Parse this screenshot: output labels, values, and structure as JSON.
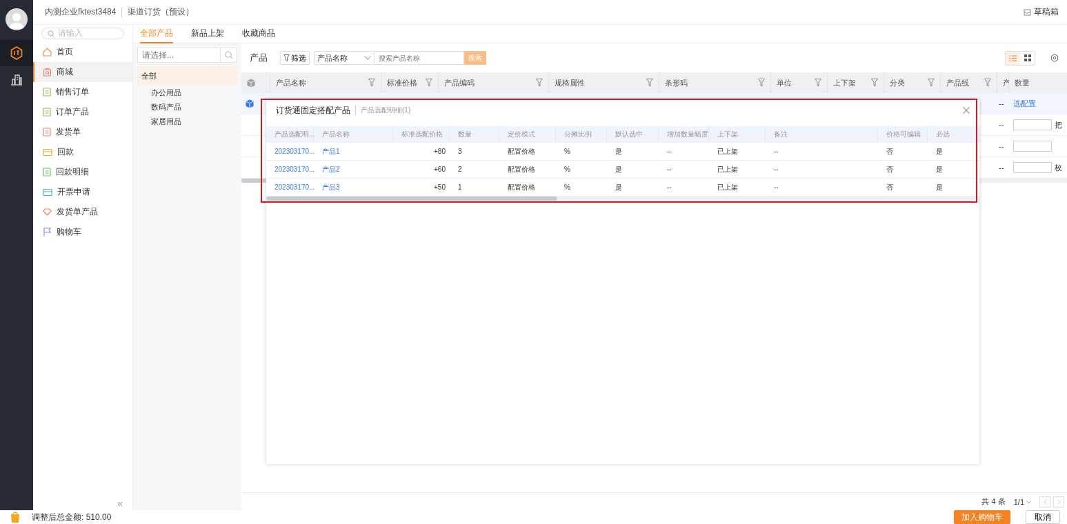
{
  "header": {
    "company": "内测企业fktest3484",
    "app": "渠道订货（预设）",
    "drafts": "草稿箱"
  },
  "rail": {
    "items": [
      {
        "kind": "order",
        "selected": true
      },
      {
        "kind": "report",
        "selected": false
      }
    ]
  },
  "sidebar": {
    "search_placeholder": "请输入",
    "collapse": "«",
    "items": [
      {
        "label": "首页",
        "kind": "home",
        "selected": false
      },
      {
        "label": "商城",
        "kind": "shop",
        "selected": true
      },
      {
        "label": "销售订单",
        "kind": "order",
        "selected": false
      },
      {
        "label": "订单产品",
        "kind": "order-product",
        "selected": false
      },
      {
        "label": "发货单",
        "kind": "delivery",
        "selected": false
      },
      {
        "label": "回款",
        "kind": "payment",
        "selected": false
      },
      {
        "label": "回款明细",
        "kind": "payment-detail",
        "selected": false
      },
      {
        "label": "开票申请",
        "kind": "invoice",
        "selected": false
      },
      {
        "label": "发货单产品",
        "kind": "delivery-product",
        "selected": false
      },
      {
        "label": "购物车",
        "kind": "cart",
        "selected": false
      }
    ]
  },
  "tabs": [
    {
      "label": "全部产品",
      "selected": true
    },
    {
      "label": "新品上架",
      "selected": false
    },
    {
      "label": "收藏商品",
      "selected": false
    }
  ],
  "category": {
    "placeholder": "请选择...",
    "tree": [
      {
        "label": "全部",
        "selected": true,
        "children": [
          {
            "label": "办公用品",
            "selected": false
          },
          {
            "label": "数码产品",
            "selected": false
          },
          {
            "label": "家居用品",
            "selected": false
          }
        ]
      }
    ]
  },
  "toolbar": {
    "title": "产品",
    "filter": "筛选",
    "field": "产品名称",
    "search_placeholder": "搜索产品名称",
    "search_button": "搜索",
    "views": [
      {
        "kind": "list",
        "selected": true
      },
      {
        "kind": "grid",
        "selected": false
      }
    ]
  },
  "table": {
    "columns": [
      {
        "label": "产品名称",
        "filter": true
      },
      {
        "label": "标准价格",
        "filter": true
      },
      {
        "label": "产品编码",
        "filter": true
      },
      {
        "label": "规格属性",
        "filter": true
      },
      {
        "label": "条形码",
        "filter": true
      },
      {
        "label": "单位",
        "filter": true
      },
      {
        "label": "上下架",
        "filter": true
      },
      {
        "label": "分类",
        "filter": true
      },
      {
        "label": "产品线",
        "filter": true
      },
      {
        "label": "产",
        "filter": false
      },
      {
        "label": "数量",
        "filter": false
      }
    ],
    "rows": [
      {
        "kind": "bundle",
        "selected": true,
        "column_11": "--",
        "quantity": {
          "kind": "link",
          "text": "选配置"
        }
      },
      {
        "kind": "plain",
        "selected": false,
        "column_11": "--",
        "quantity": {
          "kind": "input",
          "unit": "把"
        }
      },
      {
        "kind": "plain",
        "selected": false,
        "column_11": "--",
        "quantity": {
          "kind": "input"
        }
      },
      {
        "kind": "plain",
        "selected": false,
        "column_11": "--",
        "quantity": {
          "kind": "input",
          "unit": "枚"
        }
      }
    ]
  },
  "pagination": {
    "total": "共 4 条",
    "page": "1/1"
  },
  "modal": {
    "title": "订货通固定搭配产品",
    "subtitle": "产品选配明细(1)",
    "columns": [
      "产品选配明...",
      "产品名称",
      "标准选配价格",
      "数量",
      "定价模式",
      "分摊比例",
      "默认选中",
      "增加数量幅度",
      "上下架",
      "备注",
      "价格可编辑",
      "必选"
    ],
    "rows": [
      [
        "202303170...",
        "产品1",
        "+80",
        "3",
        "配置价格",
        "%",
        "是",
        "--",
        "已上架",
        "--",
        "否",
        "是"
      ],
      [
        "202303170...",
        "产品2",
        "+60",
        "2",
        "配置价格",
        "%",
        "是",
        "--",
        "已上架",
        "--",
        "否",
        "是"
      ],
      [
        "202303170...",
        "产品3",
        "+50",
        "1",
        "配置价格",
        "%",
        "是",
        "--",
        "已上架",
        "--",
        "否",
        "是"
      ]
    ]
  },
  "footer": {
    "total": "调整后总金额: 510.00",
    "buttons": [
      {
        "label": "加入购物车",
        "kind": "primary"
      },
      {
        "label": "取消",
        "kind": "default"
      }
    ]
  }
}
